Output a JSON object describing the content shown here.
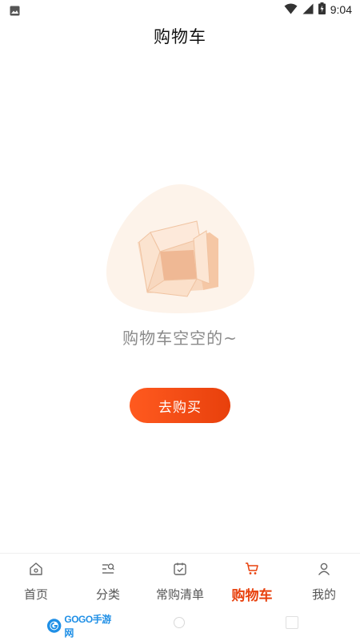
{
  "status_bar": {
    "time": "9:04",
    "icons": [
      "image-notification-icon",
      "wifi-icon",
      "signal-icon",
      "battery-charging-icon"
    ]
  },
  "header": {
    "title": "购物车"
  },
  "empty_state": {
    "illustration": "empty-box-icon",
    "message": "购物车空空的~",
    "action_label": "去购买"
  },
  "tab_bar": {
    "tabs": [
      {
        "label": "首页",
        "icon": "home-icon",
        "active": false
      },
      {
        "label": "分类",
        "icon": "category-icon",
        "active": false
      },
      {
        "label": "常购清单",
        "icon": "frequent-list-icon",
        "active": false
      },
      {
        "label": "购物车",
        "icon": "cart-icon",
        "active": true
      },
      {
        "label": "我的",
        "icon": "user-icon",
        "active": false
      }
    ]
  },
  "watermark": {
    "text": "GOGO手游网"
  },
  "colors": {
    "accent": "#e8400c",
    "empty_text": "#8a8a8a",
    "illustration_bg": "#fdf3ea"
  }
}
